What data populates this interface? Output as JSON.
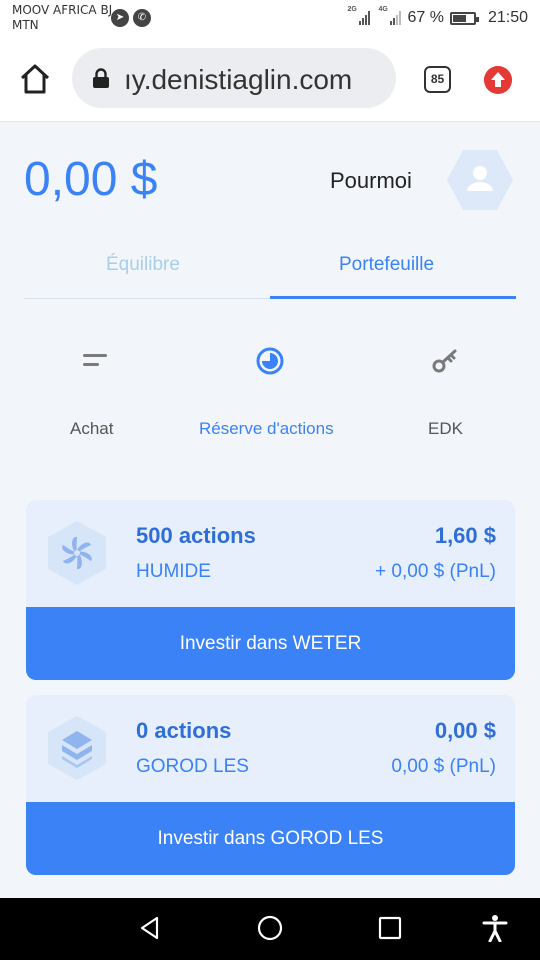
{
  "status_bar": {
    "carrier_line1": "MOOV AFRICA BJ",
    "carrier_line2": "MTN",
    "network1": "2G",
    "network2": "4G",
    "battery": "67 %",
    "time": "21:50"
  },
  "browser": {
    "url": "ıy.denistiaglin.com",
    "tab_count": "85"
  },
  "header": {
    "balance": "0,00 $",
    "username": "Pourmoi"
  },
  "tabs": [
    {
      "label": "Équilibre",
      "active": false
    },
    {
      "label": "Portefeuille",
      "active": true
    }
  ],
  "subnav": [
    {
      "label": "Achat",
      "icon": "menu-lines-icon",
      "active": false
    },
    {
      "label": "Réserve d'actions",
      "icon": "pie-chart-icon",
      "active": true
    },
    {
      "label": "EDK",
      "icon": "key-icon",
      "active": false
    }
  ],
  "cards": [
    {
      "shares": "500 actions",
      "company": "HUMIDE",
      "price": "1,60 $",
      "pnl": "+ 0,00 $ (PnL)",
      "button": "Investir dans WETER",
      "icon": "fan-icon"
    },
    {
      "shares": "0 actions",
      "company": "GOROD LES",
      "price": "0,00 $",
      "pnl": "0,00 $ (PnL)",
      "button": "Investir dans GOROD LES",
      "icon": "layers-icon"
    }
  ],
  "colors": {
    "accent": "#3b82f6",
    "card_bg": "#e6effb",
    "page_bg": "#f2f6fb"
  }
}
